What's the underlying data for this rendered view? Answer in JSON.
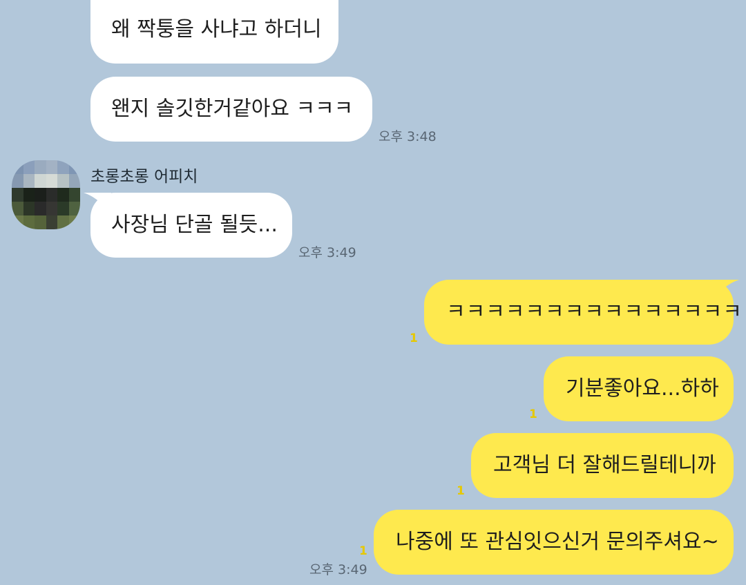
{
  "chat": {
    "sender_name": "초롱초롱 어피치",
    "messages": [
      {
        "side": "in",
        "text": "왜 짝퉁을 사냐고 하더니"
      },
      {
        "side": "in",
        "text": "왠지 솔깃한거같아요 ㅋㅋㅋ",
        "time": "오후 3:48"
      },
      {
        "side": "in",
        "text": "사장님 단골 될듯...",
        "time": "오후 3:49"
      },
      {
        "side": "out",
        "text": "ㅋㅋㅋㅋㅋㅋㅋㅋㅋㅋㅋㅋㅋㅋㅋ",
        "unread": "1"
      },
      {
        "side": "out",
        "text": "기분좋아요...하하",
        "unread": "1"
      },
      {
        "side": "out",
        "text": "고객님 더 잘해드릴테니까",
        "unread": "1"
      },
      {
        "side": "out",
        "text": "나중에 또 관심잇으신거 문의주셔요~",
        "unread": "1",
        "time": "오후 3:49"
      }
    ]
  },
  "colors": {
    "background": "#b2c7da",
    "incoming_bubble": "#ffffff",
    "outgoing_bubble": "#fee94e",
    "unread_count": "#e6c800",
    "timestamp": "#596673"
  },
  "icons": {
    "avatar": "pixelated-profile-photo"
  }
}
